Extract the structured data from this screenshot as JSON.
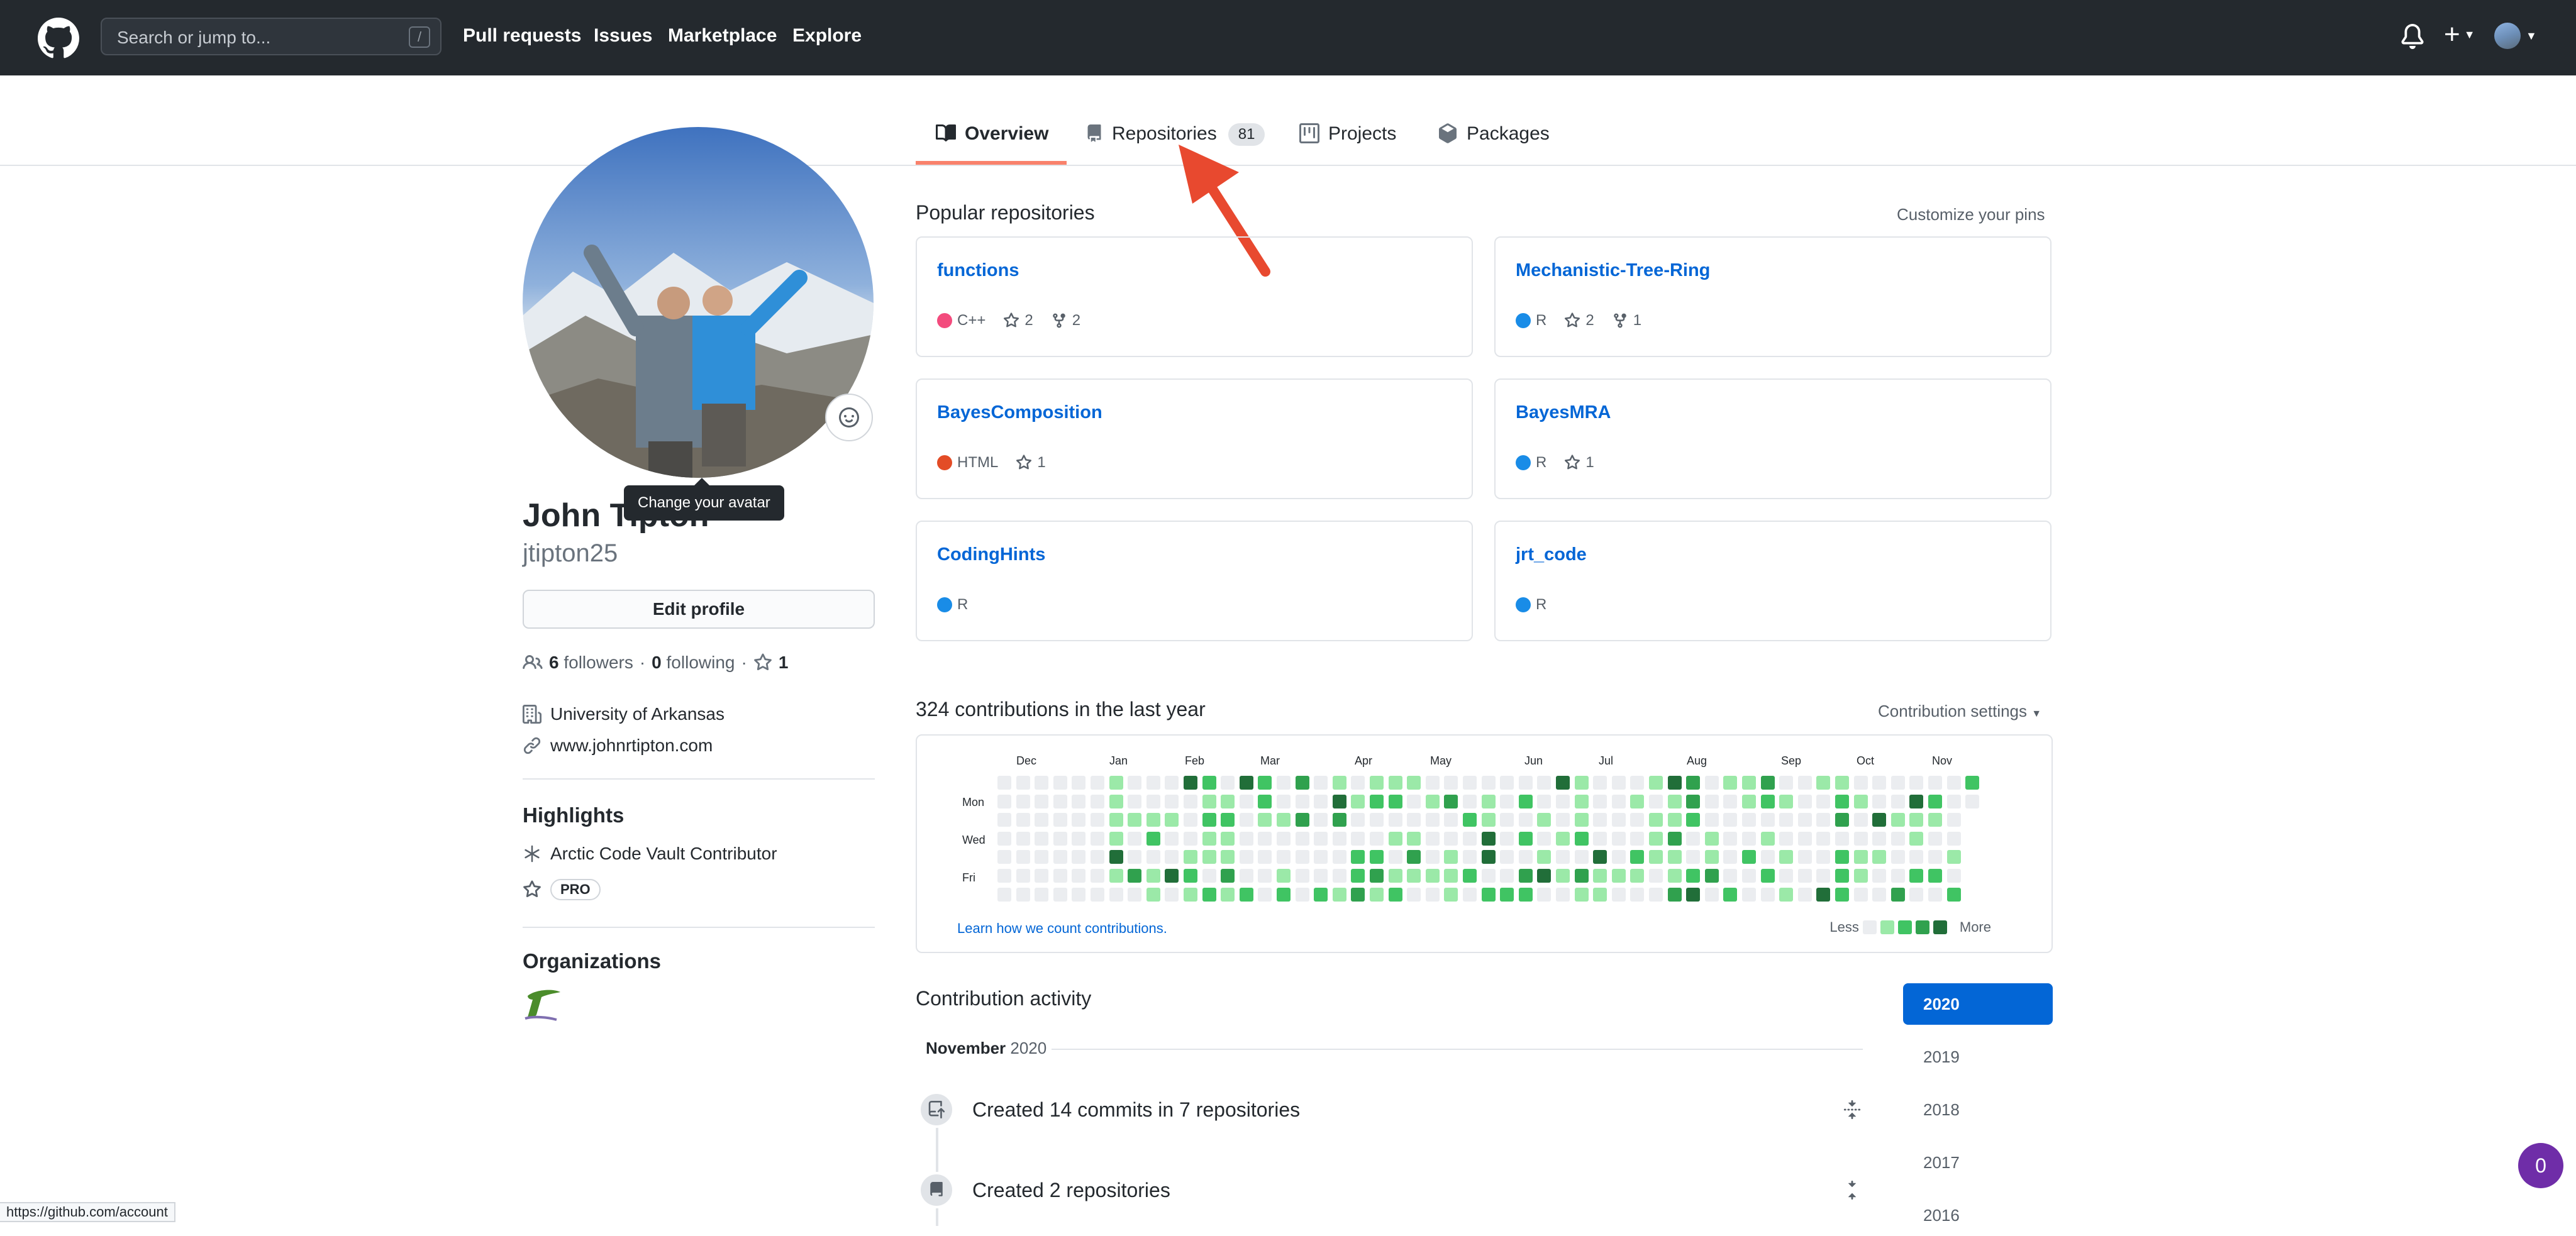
{
  "header": {
    "search_placeholder": "Search or jump to...",
    "search_shortcut": "/",
    "nav": [
      "Pull requests",
      "Issues",
      "Marketplace",
      "Explore"
    ]
  },
  "tabs": [
    {
      "label": "Overview",
      "icon": "book-icon"
    },
    {
      "label": "Repositories",
      "icon": "repo-icon",
      "count": "81"
    },
    {
      "label": "Projects",
      "icon": "project-icon"
    },
    {
      "label": "Packages",
      "icon": "package-icon"
    }
  ],
  "profile": {
    "name": "John Tipton",
    "username": "jtipton25",
    "avatar_tooltip": "Change your avatar",
    "edit_button": "Edit profile",
    "followers_count": "6",
    "followers_label": "followers",
    "following_count": "0",
    "following_label": "following",
    "stars": "1",
    "organization": "University of Arkansas",
    "website": "www.johnrtipton.com",
    "highlights_title": "Highlights",
    "highlight_item": "Arctic Code Vault Contributor",
    "pro_label": "PRO",
    "organizations_title": "Organizations"
  },
  "popular": {
    "title": "Popular repositories",
    "customize": "Customize your pins",
    "repos": [
      {
        "name": "functions",
        "language": "C++",
        "lang_color": "#f34b7d",
        "stars": "2",
        "forks": "2"
      },
      {
        "name": "Mechanistic-Tree-Ring",
        "language": "R",
        "lang_color": "#198ce7",
        "stars": "2",
        "forks": "1"
      },
      {
        "name": "BayesComposition",
        "language": "HTML",
        "lang_color": "#e34c26",
        "stars": "1"
      },
      {
        "name": "BayesMRA",
        "language": "R",
        "lang_color": "#198ce7",
        "stars": "1"
      },
      {
        "name": "CodingHints",
        "language": "R",
        "lang_color": "#198ce7"
      },
      {
        "name": "jrt_code",
        "language": "R",
        "lang_color": "#198ce7"
      }
    ]
  },
  "contributions": {
    "title": "324 contributions in the last year",
    "settings": "Contribution settings",
    "months": [
      "Dec",
      "Jan",
      "Feb",
      "Mar",
      "Apr",
      "May",
      "Jun",
      "Jul",
      "Aug",
      "Sep",
      "Oct",
      "Nov"
    ],
    "day_labels": [
      "Mon",
      "Wed",
      "Fri"
    ],
    "learn_link": "Learn how we count contributions.",
    "legend_less": "Less",
    "legend_more": "More",
    "colors": [
      "#ebedf0",
      "#9be9a8",
      "#40c463",
      "#30a14e",
      "#216e39"
    ]
  },
  "activity": {
    "title": "Contribution activity",
    "month": "November",
    "year": "2020",
    "items": [
      "Created 14 commits in 7 repositories",
      "Created 2 repositories"
    ],
    "years": [
      "2020",
      "2019",
      "2018",
      "2017",
      "2016"
    ]
  },
  "status_url": "https://github.com/account",
  "notification_badge": "0"
}
